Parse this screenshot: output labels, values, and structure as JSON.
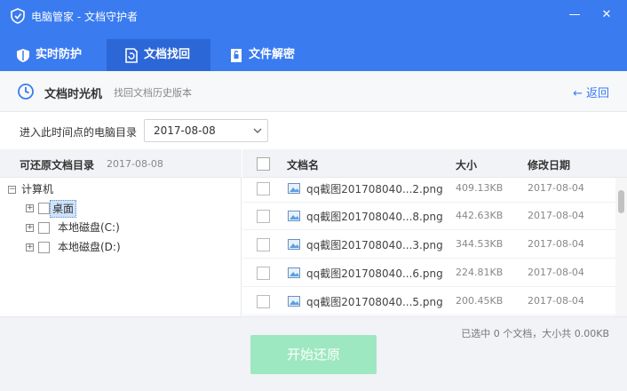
{
  "window": {
    "title": "电脑管家 - 文档守护者",
    "minimize_glyph": "—",
    "close_glyph": "✕"
  },
  "tabs": [
    {
      "label": "实时防护",
      "icon": "shield-icon",
      "active": false
    },
    {
      "label": "文档找回",
      "icon": "document-restore-icon",
      "active": true
    },
    {
      "label": "文件解密",
      "icon": "unlock-file-icon",
      "active": false
    }
  ],
  "header": {
    "title": "文档时光机",
    "subtitle": "找回文档历史版本",
    "back_label": "返回"
  },
  "date_picker": {
    "label": "进入此时间点的电脑目录",
    "value": "2017-08-08"
  },
  "tree": {
    "header_title": "可还原文档目录",
    "header_date": "2017-08-08",
    "root": "计算机",
    "nodes": [
      {
        "label": "桌面",
        "selected": true
      },
      {
        "label": "本地磁盘(C:)",
        "selected": false
      },
      {
        "label": "本地磁盘(D:)",
        "selected": false
      }
    ],
    "expand_glyph": "+",
    "collapse_glyph": "−"
  },
  "file_table": {
    "columns": [
      "文档名",
      "大小",
      "修改日期"
    ],
    "rows": [
      {
        "name": "qq截图201708040...2.png",
        "size": "409.13KB",
        "date": "2017-08-04"
      },
      {
        "name": "qq截图201708040...8.png",
        "size": "442.63KB",
        "date": "2017-08-04"
      },
      {
        "name": "qq截图201708040...3.png",
        "size": "344.53KB",
        "date": "2017-08-04"
      },
      {
        "name": "qq截图201708040...6.png",
        "size": "224.81KB",
        "date": "2017-08-04"
      },
      {
        "name": "qq截图201708040...5.png",
        "size": "200.45KB",
        "date": "2017-08-04"
      }
    ]
  },
  "footer": {
    "summary": "已选中 0 个文档，大小共 0.00KB",
    "restore_button": "开始还原"
  },
  "colors": {
    "brand": "#3a7bf0",
    "tab_active": "#2c67d8",
    "restore_button": "#9de8c0"
  }
}
